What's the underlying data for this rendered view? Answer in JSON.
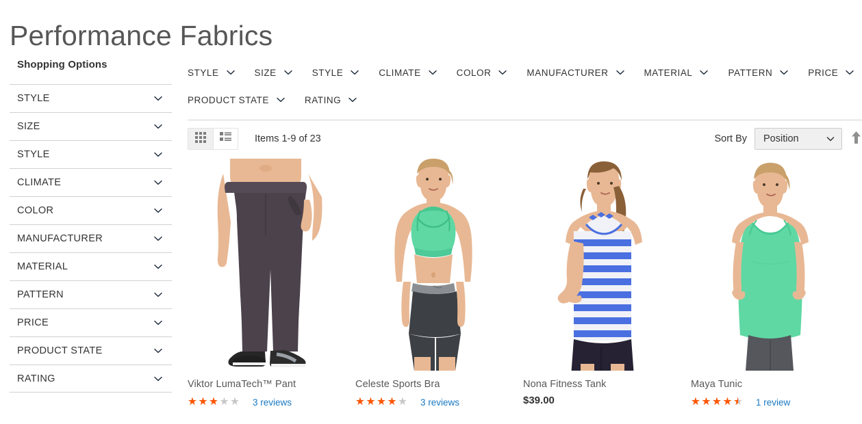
{
  "page": {
    "title": "Performance Fabrics"
  },
  "sidebar": {
    "heading": "Shopping Options",
    "items": [
      {
        "label": "STYLE",
        "icon": "chevron-down-icon"
      },
      {
        "label": "SIZE",
        "icon": "chevron-down-icon"
      },
      {
        "label": "STYLE",
        "icon": "chevron-down-icon"
      },
      {
        "label": "CLIMATE",
        "icon": "chevron-down-icon"
      },
      {
        "label": "COLOR",
        "icon": "chevron-down-icon"
      },
      {
        "label": "MANUFACTURER",
        "icon": "chevron-down-icon"
      },
      {
        "label": "MATERIAL",
        "icon": "chevron-down-icon"
      },
      {
        "label": "PATTERN",
        "icon": "chevron-down-icon"
      },
      {
        "label": "PRICE",
        "icon": "chevron-down-icon"
      },
      {
        "label": "PRODUCT STATE",
        "icon": "chevron-down-icon"
      },
      {
        "label": "RATING",
        "icon": "chevron-down-icon"
      }
    ]
  },
  "filter_bar": {
    "row1": [
      {
        "label": "STYLE",
        "icon": "chevron-down-icon"
      },
      {
        "label": "SIZE",
        "icon": "chevron-down-icon"
      },
      {
        "label": "STYLE",
        "icon": "chevron-down-icon"
      },
      {
        "label": "CLIMATE",
        "icon": "chevron-down-icon"
      },
      {
        "label": "COLOR",
        "icon": "chevron-down-icon"
      },
      {
        "label": "MANUFACTURER",
        "icon": "chevron-down-icon"
      },
      {
        "label": "MATERIAL",
        "icon": "chevron-down-icon"
      },
      {
        "label": "PATTERN",
        "icon": "chevron-down-icon"
      },
      {
        "label": "PRICE",
        "icon": "chevron-down-icon"
      }
    ],
    "row2": [
      {
        "label": "PRODUCT STATE",
        "icon": "chevron-down-icon"
      },
      {
        "label": "RATING",
        "icon": "chevron-down-icon"
      }
    ]
  },
  "toolbar": {
    "grid_view": {
      "icon": "grid-view-icon",
      "active": false
    },
    "list_view": {
      "icon": "list-view-icon",
      "active": true
    },
    "items_count": "Items 1-9 of 23",
    "sort_label": "Sort By",
    "sort_value": "Position",
    "sort_chevron_icon": "chevron-down-icon",
    "sort_direction_icon": "arrow-up-icon"
  },
  "colors": {
    "star_filled": "#ff5501",
    "star_empty": "#c7c7c7",
    "link": "#1979c3",
    "text": "#333333",
    "title": "#575757"
  },
  "products": [
    {
      "name": "Viktor LumaTech™ Pant",
      "rating_stars": 2.5,
      "reviews_text": "3 reviews",
      "price": "",
      "image": "male-model-gray-pant"
    },
    {
      "name": "Celeste Sports Bra",
      "rating_stars": 3.5,
      "reviews_text": "3 reviews",
      "price": "",
      "image": "female-model-mint-sports-bra"
    },
    {
      "name": "Nona Fitness Tank",
      "rating_stars": 0,
      "reviews_text": "",
      "price": "$39.00",
      "image": "female-model-striped-tank"
    },
    {
      "name": "Maya Tunic",
      "rating_stars": 4,
      "reviews_text": "1 review",
      "price": "",
      "image": "female-model-mint-tunic"
    }
  ]
}
